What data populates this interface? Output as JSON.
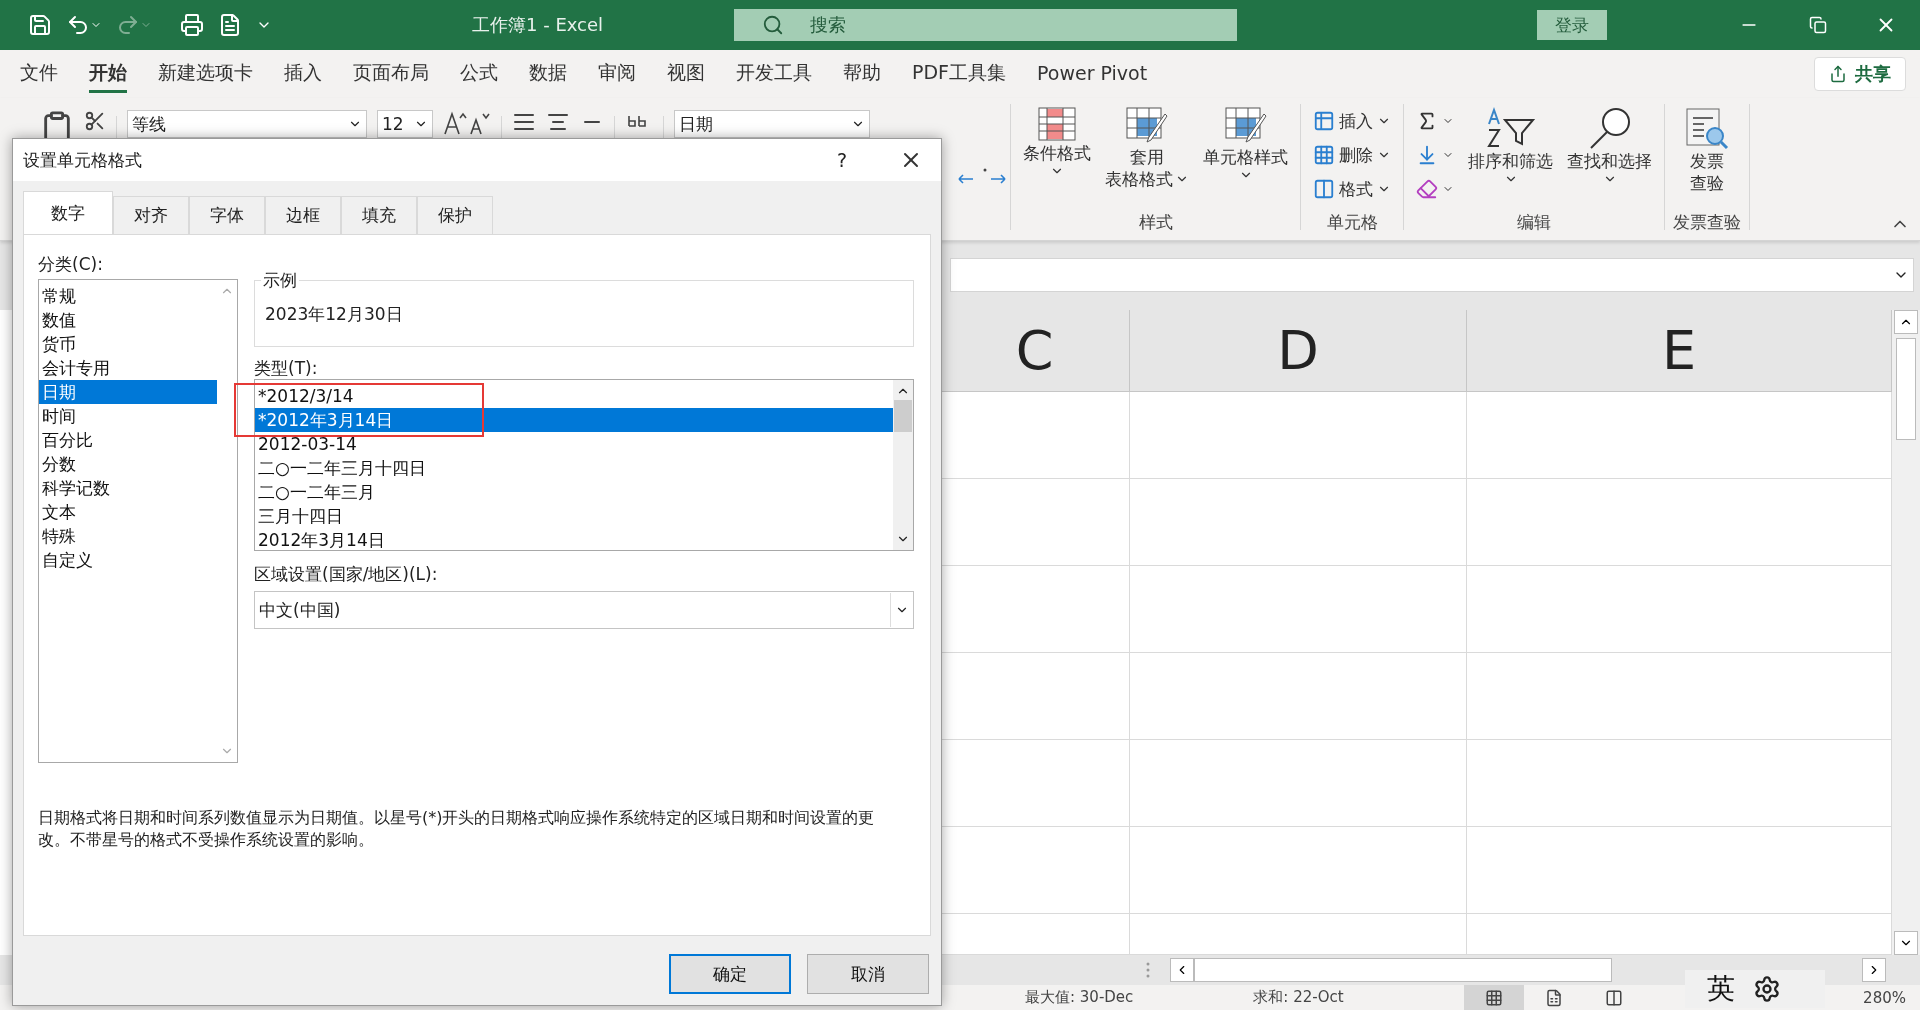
{
  "title_bar": {
    "title": "工作簿1  -  Excel",
    "search": {
      "placeholder": "搜索"
    },
    "login": "登录"
  },
  "ribbon_tabs": [
    {
      "label": "文件",
      "selected": false
    },
    {
      "label": "开始",
      "selected": true
    },
    {
      "label": "新建选项卡",
      "selected": false
    },
    {
      "label": "插入",
      "selected": false
    },
    {
      "label": "页面布局",
      "selected": false
    },
    {
      "label": "公式",
      "selected": false
    },
    {
      "label": "数据",
      "selected": false
    },
    {
      "label": "审阅",
      "selected": false
    },
    {
      "label": "视图",
      "selected": false
    },
    {
      "label": "开发工具",
      "selected": false
    },
    {
      "label": "帮助",
      "selected": false
    },
    {
      "label": "PDF工具集",
      "selected": false
    },
    {
      "label": "Power Pivot",
      "selected": false
    }
  ],
  "share": "共享",
  "ribbon": {
    "font": "等线",
    "font_size": "12",
    "number_format": "日期",
    "groups": [
      {
        "label": "样式",
        "buttons": [
          {
            "kind": "large",
            "lines": [
              "条件格式"
            ],
            "has_menu": true
          },
          {
            "kind": "large",
            "lines": [
              "套用",
              "表格格式"
            ],
            "has_menu": true
          },
          {
            "kind": "large",
            "lines": [
              "单元格样式"
            ],
            "has_menu": true
          }
        ]
      },
      {
        "label": "单元格",
        "buttons": [
          {
            "kind": "small",
            "lines": [
              "插入"
            ],
            "has_menu": true
          },
          {
            "kind": "small",
            "lines": [
              "删除"
            ],
            "has_menu": true
          },
          {
            "kind": "small",
            "lines": [
              "格式"
            ],
            "has_menu": true
          }
        ]
      },
      {
        "label": "编辑",
        "buttons": [
          {
            "kind": "tools"
          },
          {
            "kind": "large",
            "lines": [
              "排序和筛选"
            ],
            "has_menu": true
          },
          {
            "kind": "large",
            "lines": [
              "查找和选择"
            ],
            "has_menu": true
          }
        ]
      },
      {
        "label": "发票查验",
        "buttons": [
          {
            "kind": "large",
            "lines": [
              "发票",
              "查验"
            ],
            "has_menu": false
          }
        ]
      }
    ]
  },
  "sheet": {
    "columns": [
      "C",
      "D",
      "E"
    ]
  },
  "status_bar": {
    "max": "最大值: 30-Dec",
    "sum": "求和: 22-Oct",
    "zoom": "280%"
  },
  "ime": {
    "label": "英"
  },
  "dialog": {
    "title": "设置单元格格式",
    "help": "?",
    "tabs": [
      {
        "label": "数字",
        "selected": true
      },
      {
        "label": "对齐",
        "selected": false
      },
      {
        "label": "字体",
        "selected": false
      },
      {
        "label": "边框",
        "selected": false
      },
      {
        "label": "填充",
        "selected": false
      },
      {
        "label": "保护",
        "selected": false
      }
    ],
    "category_label": "分类(C):",
    "categories": [
      {
        "label": "常规",
        "selected": false
      },
      {
        "label": "数值",
        "selected": false
      },
      {
        "label": "货币",
        "selected": false
      },
      {
        "label": "会计专用",
        "selected": false
      },
      {
        "label": "日期",
        "selected": true
      },
      {
        "label": "时间",
        "selected": false
      },
      {
        "label": "百分比",
        "selected": false
      },
      {
        "label": "分数",
        "selected": false
      },
      {
        "label": "科学记数",
        "selected": false
      },
      {
        "label": "文本",
        "selected": false
      },
      {
        "label": "特殊",
        "selected": false
      },
      {
        "label": "自定义",
        "selected": false
      }
    ],
    "sample": {
      "legend": "示例",
      "value": "2023年12月30日"
    },
    "type_label": "类型(T):",
    "types": [
      {
        "label": "*2012/3/14",
        "selected": false
      },
      {
        "label": "*2012年3月14日",
        "selected": true
      },
      {
        "label": "2012-03-14",
        "selected": false
      },
      {
        "label": "二○一二年三月十四日",
        "selected": false
      },
      {
        "label": "二○一二年三月",
        "selected": false
      },
      {
        "label": "三月十四日",
        "selected": false
      },
      {
        "label": "2012年3月14日",
        "selected": false
      }
    ],
    "locale_label": "区域设置(国家/地区)(L):",
    "locale": "中文(中国)",
    "description": "日期格式将日期和时间系列数值显示为日期值。以星号(*)开头的日期格式响应操作系统特定的区域日期和时间设置的更改。不带星号的格式不受操作系统设置的影响。",
    "buttons": [
      {
        "label": "确定",
        "default": true
      },
      {
        "label": "取消",
        "default": false
      }
    ]
  }
}
